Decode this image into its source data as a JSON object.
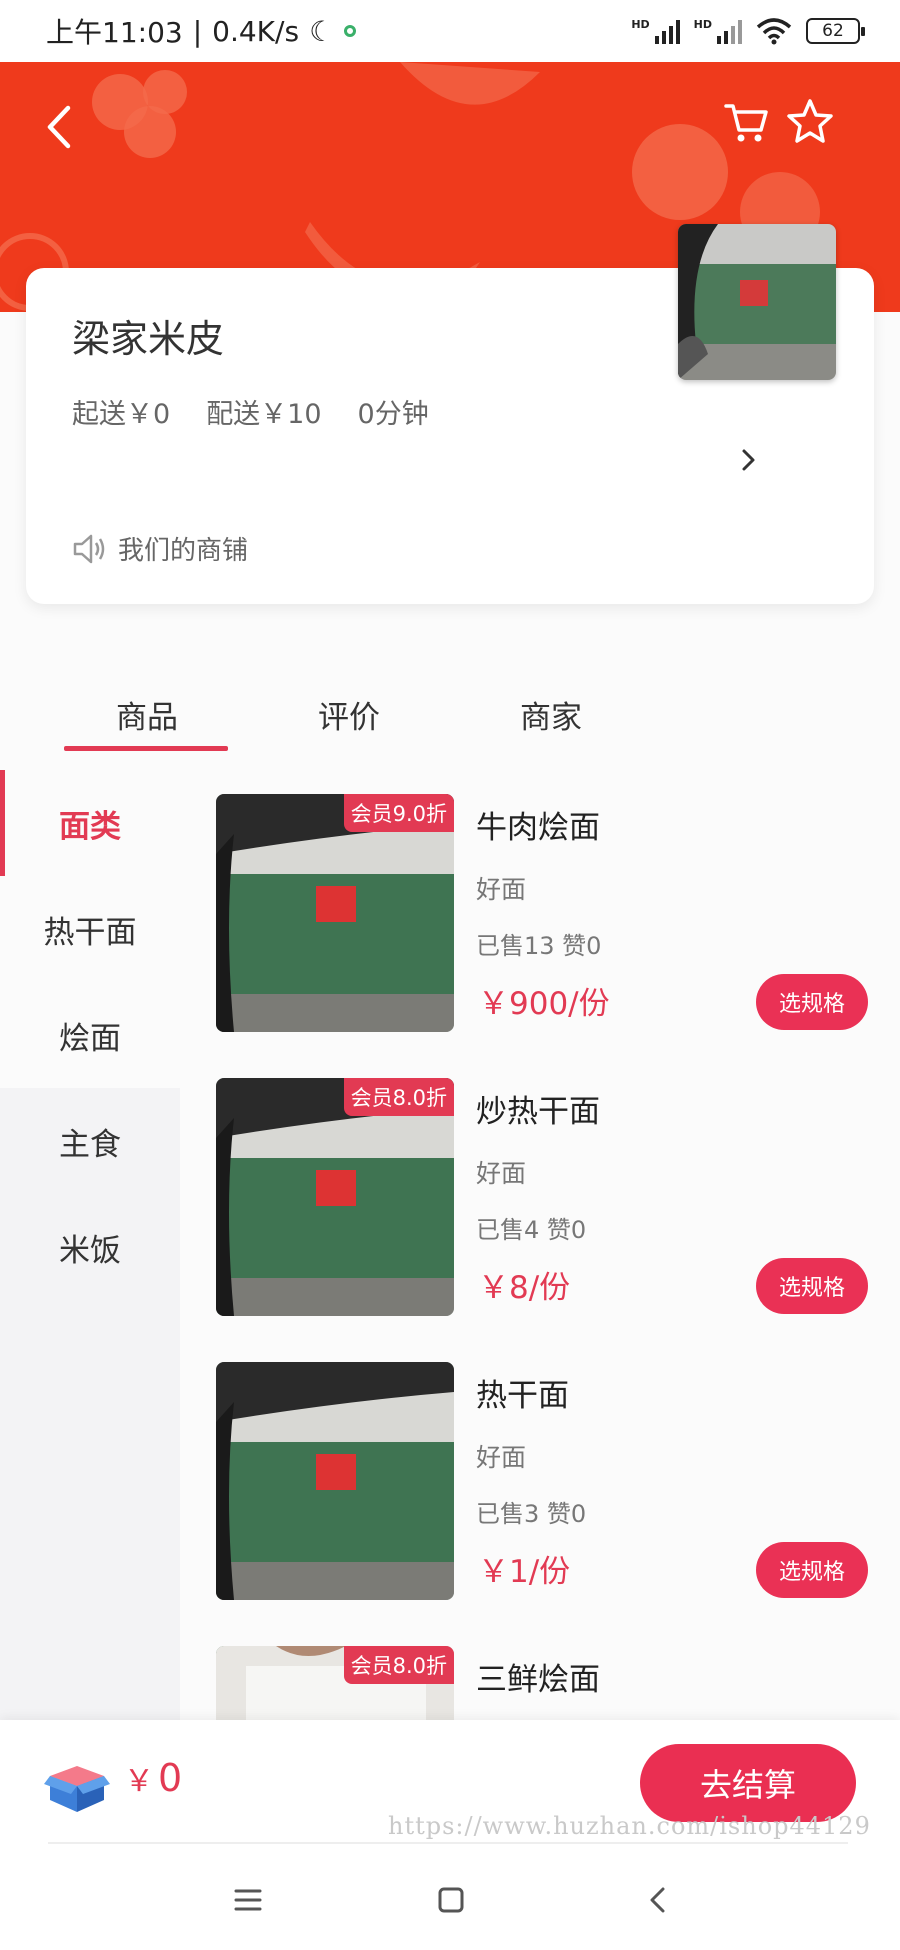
{
  "status_bar": {
    "time": "上午11:03",
    "net_speed": "0.4K/s",
    "battery": "62"
  },
  "header": {
    "brand_color": "#ef3a1c"
  },
  "shop": {
    "name": "梁家米皮",
    "min_order": "起送￥0",
    "delivery_fee": "配送￥10",
    "delivery_time": "0分钟",
    "notice": "我们的商铺"
  },
  "tabs": [
    {
      "label": "商品",
      "active": true
    },
    {
      "label": "评价",
      "active": false
    },
    {
      "label": "商家",
      "active": false
    }
  ],
  "categories": [
    {
      "label": "面类",
      "active": true
    },
    {
      "label": "热干面",
      "active": false
    },
    {
      "label": "烩面",
      "active": false
    },
    {
      "label": "主食",
      "active": false
    },
    {
      "label": "米饭",
      "active": false
    }
  ],
  "products": [
    {
      "name": "牛肉烩面",
      "desc": "好面",
      "sold": "已售13 赞0",
      "price": "￥900/份",
      "badge": "会员9.0折",
      "button": "选规格"
    },
    {
      "name": "炒热干面",
      "desc": "好面",
      "sold": "已售4 赞0",
      "price": "￥8/份",
      "badge": "会员8.0折",
      "button": "选规格"
    },
    {
      "name": "热干面",
      "desc": "好面",
      "sold": "已售3 赞0",
      "price": "￥1/份",
      "badge": "",
      "button": "选规格"
    },
    {
      "name": "三鲜烩面",
      "desc": "",
      "sold": "",
      "price": "",
      "badge": "会员8.0折",
      "button": ""
    }
  ],
  "cart": {
    "currency": "￥",
    "total": "0",
    "checkout_label": "去结算",
    "watermark": "https://www.huzhan.com/ishop44129"
  },
  "colors": {
    "accent": "#e23a53",
    "button": "#ea3155"
  }
}
